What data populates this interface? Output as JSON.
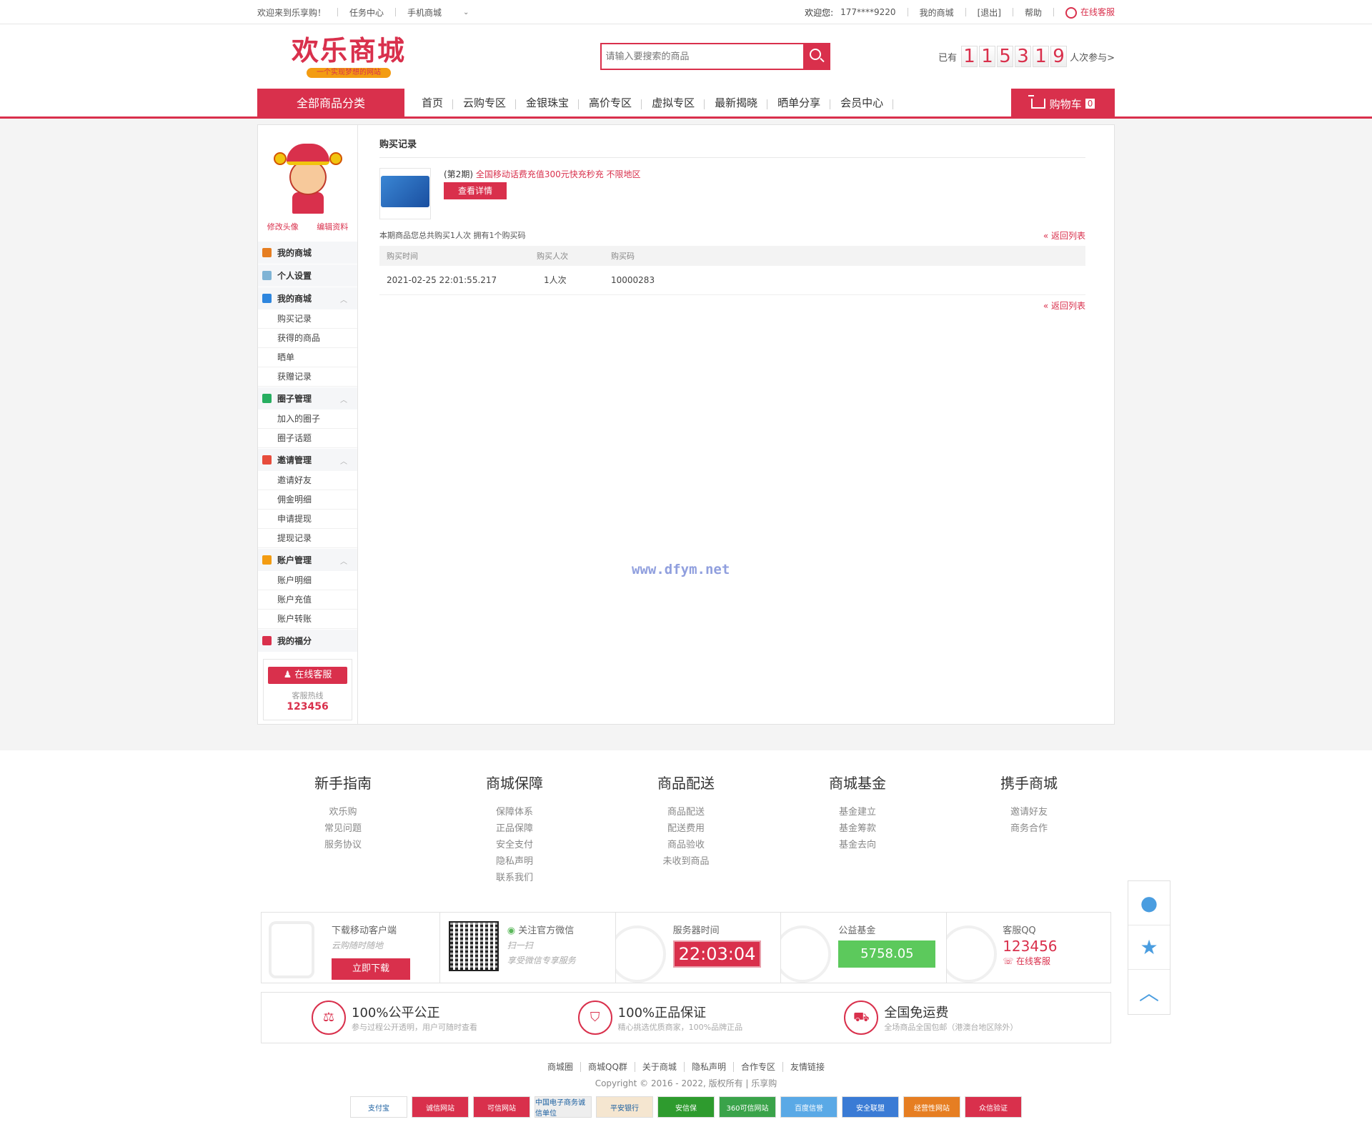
{
  "topbar": {
    "welcome": "欢迎来到乐享购！",
    "task_center": "任务中心",
    "mobile_mall": "手机商城",
    "greeting_label": "欢迎您:",
    "user_phone": "177****9220",
    "my_mall": "我的商城",
    "logout": "[退出]",
    "help": "帮助",
    "online_service": "在线客服"
  },
  "header": {
    "logo_title": "欢乐商城",
    "logo_slogan": "一个实现梦想的网站",
    "search_placeholder": "请输入要搜索的商品",
    "counter_prefix": "已有",
    "counter_digits": [
      "1",
      "1",
      "5",
      "3",
      "1",
      "9"
    ],
    "counter_suffix": "人次参与>"
  },
  "nav": {
    "all_categories": "全部商品分类",
    "items": [
      "首页",
      "云购专区",
      "金银珠宝",
      "高价专区",
      "虚拟专区",
      "最新揭晓",
      "晒单分享",
      "会员中心"
    ],
    "cart_label": "购物车",
    "cart_count": "0"
  },
  "sidebar": {
    "edit_avatar": "修改头像",
    "edit_profile": "编辑资料",
    "groups": [
      {
        "label": "我的商城",
        "color": "#e67e22",
        "items": []
      },
      {
        "label": "个人设置",
        "color": "#7fb3d5",
        "items": []
      },
      {
        "label": "我的商城",
        "color": "#2e86de",
        "items": [
          "购买记录",
          "获得的商品",
          "晒单",
          "获赠记录"
        ]
      },
      {
        "label": "圈子管理",
        "color": "#27ae60",
        "items": [
          "加入的圈子",
          "圈子话题"
        ]
      },
      {
        "label": "邀请管理",
        "color": "#e74c3c",
        "items": [
          "邀请好友",
          "佣金明细",
          "申请提现",
          "提现记录"
        ]
      },
      {
        "label": "账户管理",
        "color": "#f39c12",
        "items": [
          "账户明细",
          "账户充值",
          "账户转账"
        ]
      },
      {
        "label": "我的福分",
        "color": "#d9304c",
        "items": []
      }
    ],
    "cs_button": "在线客服",
    "cs_hotline_label": "客服热线",
    "cs_hotline": "123456"
  },
  "content": {
    "section_title": "购买记录",
    "product_issue": "(第2期)",
    "product_name": "全国移动话费充值300元快充秒充 不限地区",
    "detail_button": "查看详情",
    "summary": "本期商品您总共购买1人次 拥有1个购买码",
    "back_to_list": "返回列表",
    "table_headers": [
      "购买时间",
      "购买人次",
      "购买码"
    ],
    "rows": [
      [
        "2021-02-25 22:01:55.217",
        "1人次",
        "10000283"
      ]
    ],
    "watermark": "www.dfym.net"
  },
  "footer": {
    "columns": [
      {
        "title": "新手指南",
        "links": [
          "欢乐购",
          "常见问题",
          "服务协议"
        ]
      },
      {
        "title": "商城保障",
        "links": [
          "保障体系",
          "正品保障",
          "安全支付",
          "隐私声明",
          "联系我们"
        ]
      },
      {
        "title": "商品配送",
        "links": [
          "商品配送",
          "配送费用",
          "商品验收",
          "未收到商品"
        ]
      },
      {
        "title": "商城基金",
        "links": [
          "基金建立",
          "基金筹款",
          "基金去向"
        ]
      },
      {
        "title": "携手商城",
        "links": [
          "邀请好友",
          "商务合作"
        ]
      }
    ],
    "app_label": "下载移动客户端",
    "app_sub": "云购随时随地",
    "app_button": "立即下载",
    "wechat_label": "关注官方微信",
    "wechat_sub1": "扫一扫",
    "wechat_sub2": "享受微信专享服务",
    "server_time_label": "服务器时间",
    "server_time": "22:03:04",
    "fund_label": "公益基金",
    "fund_value": "5758.05",
    "qq_label": "客服QQ",
    "qq_number": "123456",
    "qq_online": "在线客服",
    "guarantees": [
      {
        "title": "100%公平公正",
        "desc": "参与过程公开透明，用户可随时查看"
      },
      {
        "title": "100%正品保证",
        "desc": "精心挑选优质商家，100%品牌正品"
      },
      {
        "title": "全国免运费",
        "desc": "全场商品全国包邮（港澳台地区除外）"
      }
    ],
    "bottom_links": [
      "商城圈",
      "商城QQ群",
      "关于商城",
      "隐私声明",
      "合作专区",
      "友情链接"
    ],
    "copyright": "Copyright © 2016 - 2022, 版权所有 | 乐享购",
    "badges": [
      "支付宝",
      "诚信网站",
      "可信网站",
      "中国电子商务诚信单位",
      "平安银行",
      "安信保",
      "360可信网站",
      "百度信誉",
      "安全联盟",
      "经营性网站",
      "众信验证"
    ]
  }
}
